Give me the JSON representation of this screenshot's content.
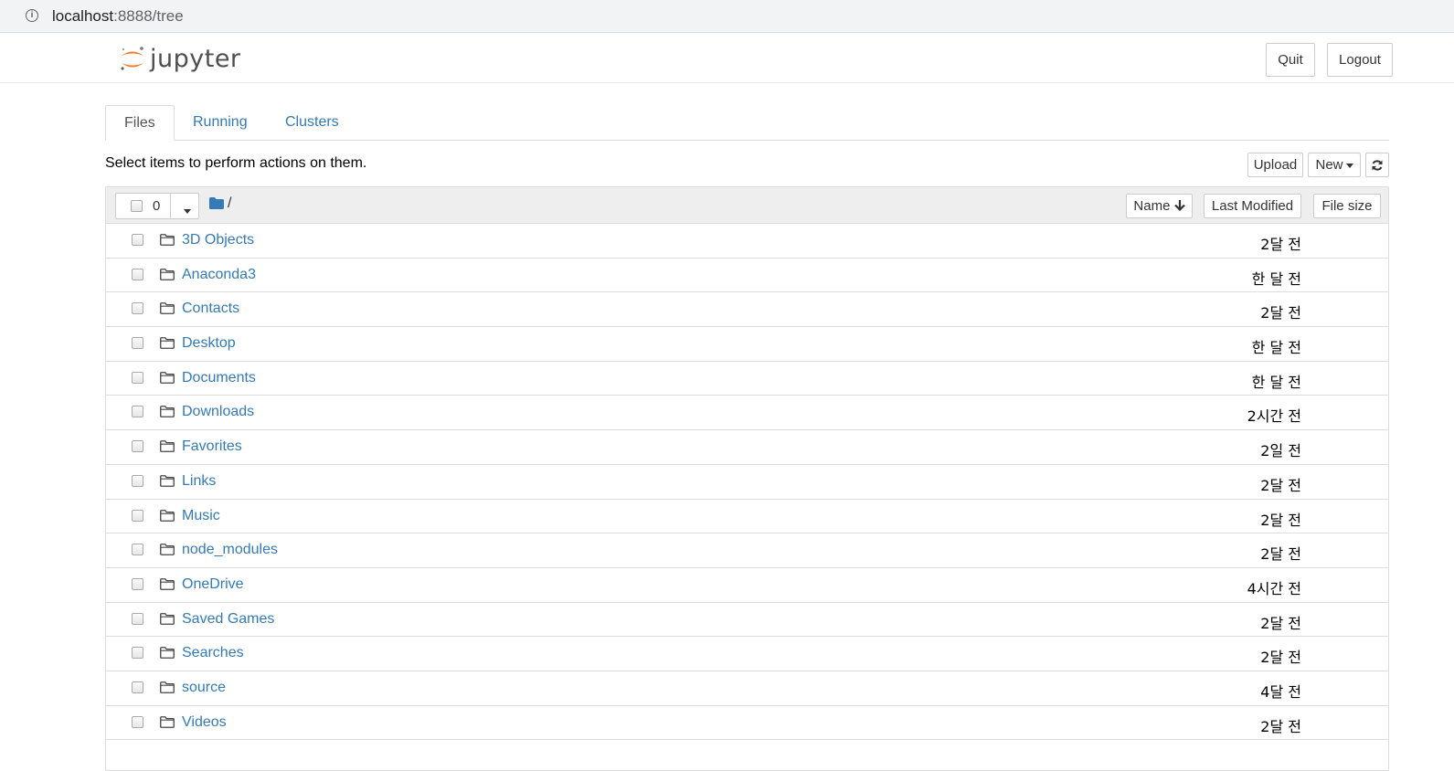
{
  "browser": {
    "url_host": "localhost",
    "url_path": ":8888/tree"
  },
  "header": {
    "logo_text": "jupyter",
    "quit_label": "Quit",
    "logout_label": "Logout"
  },
  "tabs": [
    {
      "label": "Files",
      "active": true
    },
    {
      "label": "Running",
      "active": false
    },
    {
      "label": "Clusters",
      "active": false
    }
  ],
  "toolbar": {
    "hint": "Select items to perform actions on them.",
    "upload_label": "Upload",
    "new_label": "New"
  },
  "list_header": {
    "selected_count": "0",
    "path": "/",
    "sort_name_label": "Name",
    "sort_modified_label": "Last Modified",
    "sort_size_label": "File size"
  },
  "files": [
    {
      "name": "3D Objects",
      "modified": "2달 전"
    },
    {
      "name": "Anaconda3",
      "modified": "한 달 전"
    },
    {
      "name": "Contacts",
      "modified": "2달 전"
    },
    {
      "name": "Desktop",
      "modified": "한 달 전"
    },
    {
      "name": "Documents",
      "modified": "한 달 전"
    },
    {
      "name": "Downloads",
      "modified": "2시간 전"
    },
    {
      "name": "Favorites",
      "modified": "2일 전"
    },
    {
      "name": "Links",
      "modified": "2달 전"
    },
    {
      "name": "Music",
      "modified": "2달 전"
    },
    {
      "name": "node_modules",
      "modified": "2달 전"
    },
    {
      "name": "OneDrive",
      "modified": "4시간 전"
    },
    {
      "name": "Saved Games",
      "modified": "2달 전"
    },
    {
      "name": "Searches",
      "modified": "2달 전"
    },
    {
      "name": "source",
      "modified": "4달 전"
    },
    {
      "name": "Videos",
      "modified": "2달 전"
    }
  ],
  "colors": {
    "link": "#337ab7",
    "jupyter_orange": "#f37726",
    "header_bar": "#eeeeee"
  }
}
